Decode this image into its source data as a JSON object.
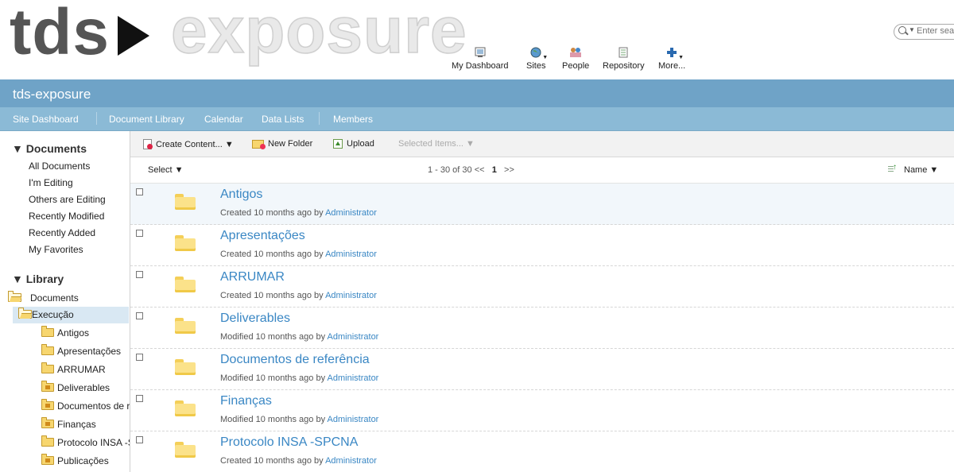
{
  "header": {
    "logo_left": "tds",
    "logo_right": "exposure",
    "app_items": [
      {
        "label": "My Dashboard",
        "icon": "dashboard-icon"
      },
      {
        "label": "Sites",
        "icon": "globe-icon"
      },
      {
        "label": "People",
        "icon": "people-icon"
      },
      {
        "label": "Repository",
        "icon": "repository-icon"
      },
      {
        "label": "More...",
        "icon": "plus-icon"
      }
    ],
    "search_placeholder": "Enter search terms"
  },
  "site": {
    "title": "tds-exposure",
    "nav": [
      "Site Dashboard",
      "Document Library",
      "Calendar",
      "Data Lists",
      "Members"
    ]
  },
  "sidebar": {
    "documents_heading": "▼ Documents",
    "document_filters": [
      "All Documents",
      "I'm Editing",
      "Others are Editing",
      "Recently Modified",
      "Recently Added",
      "My Favorites"
    ],
    "library_heading": "▼ Library",
    "tree": [
      {
        "label": "Documents",
        "level": 0,
        "icon": "open-folder-icon"
      },
      {
        "label": "Execução",
        "level": 1,
        "icon": "open-folder-icon",
        "selected": true
      },
      {
        "label": "Antigos",
        "level": 2,
        "icon": "folder-icon"
      },
      {
        "label": "Apresentações",
        "level": 2,
        "icon": "folder-icon"
      },
      {
        "label": "ARRUMAR",
        "level": 2,
        "icon": "folder-icon"
      },
      {
        "label": "Deliverables",
        "level": 2,
        "icon": "folder-icon"
      },
      {
        "label": "Documentos de referência",
        "level": 2,
        "icon": "folder-icon"
      },
      {
        "label": "Finanças",
        "level": 2,
        "icon": "folder-icon"
      },
      {
        "label": "Protocolo INSA -SPCNA",
        "level": 2,
        "icon": "folder-icon"
      },
      {
        "label": "Publicações",
        "level": 2,
        "icon": "folder-icon"
      }
    ]
  },
  "toolbar": {
    "create_content": "Create Content... ▼",
    "new_folder": "New Folder",
    "upload": "Upload",
    "selected_items": "Selected Items... ▼"
  },
  "list_header": {
    "select": "Select ▼",
    "pagination": "1 - 30 of 30  <<",
    "current_page": "1",
    "next": ">>",
    "sort": "Name ▼"
  },
  "rows": [
    {
      "title": "Antigos",
      "meta": "Created 10 months ago by",
      "by": "Administrator"
    },
    {
      "title": "Apresentações",
      "meta": "Created 10 months ago by",
      "by": "Administrator"
    },
    {
      "title": "ARRUMAR",
      "meta": "Created 10 months ago by",
      "by": "Administrator"
    },
    {
      "title": "Deliverables",
      "meta": "Modified 10 months ago by",
      "by": "Administrator"
    },
    {
      "title": "Documentos de referência",
      "meta": "Modified 10 months ago by",
      "by": "Administrator"
    },
    {
      "title": "Finanças",
      "meta": "Modified 10 months ago by",
      "by": "Administrator"
    },
    {
      "title": "Protocolo INSA -SPCNA",
      "meta": "Created 10 months ago by",
      "by": "Administrator"
    }
  ],
  "colors": {
    "title_bar": "#6fa3c7",
    "nav_bar": "#8bbad6",
    "link": "#3a87c4",
    "selected_tree": "#d9e8f3"
  }
}
